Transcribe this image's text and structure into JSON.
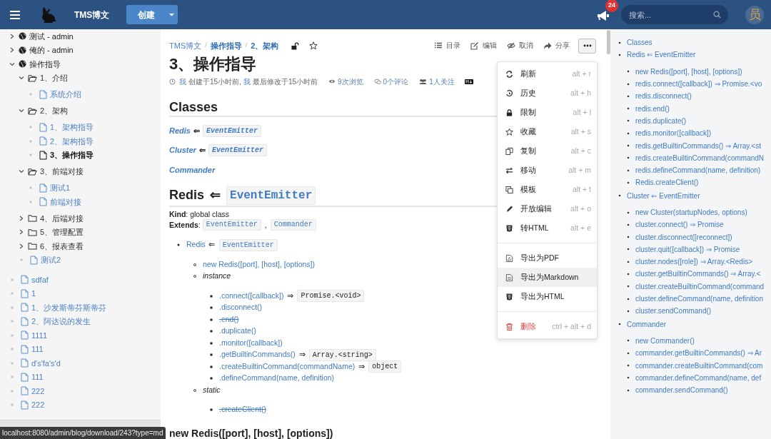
{
  "header": {
    "brand": "TMS博文",
    "create_button": "创建",
    "notification_count": "24",
    "search": {
      "placeholder": "搜索..."
    },
    "avatar": "员"
  },
  "sidebar": {
    "tree": [
      {
        "kind": "group",
        "label": "测试 - admin",
        "expanded": false
      },
      {
        "kind": "group",
        "label": "俺的 - admin",
        "expanded": false
      },
      {
        "kind": "group",
        "label": "操作指导",
        "expanded": true,
        "children": [
          {
            "kind": "folder",
            "label": "1、介绍",
            "expanded": true,
            "children": [
              {
                "kind": "doc",
                "label": "系统介绍",
                "selected": false
              }
            ]
          },
          {
            "kind": "folder",
            "label": "2、架构",
            "expanded": true,
            "children": [
              {
                "kind": "doc",
                "label": "1、架构指导",
                "selected": false
              },
              {
                "kind": "doc",
                "label": "2、架构指导",
                "selected": false
              },
              {
                "kind": "doc",
                "label": "3、操作指导",
                "selected": true
              }
            ]
          },
          {
            "kind": "folder",
            "label": "3、前端对接",
            "expanded": true,
            "children": [
              {
                "kind": "doc",
                "label": "测试1",
                "selected": false
              },
              {
                "kind": "doc",
                "label": "前端对接",
                "selected": false
              }
            ]
          },
          {
            "kind": "folder",
            "label": "4、后端对接",
            "expanded": false
          },
          {
            "kind": "folder",
            "label": "5、管理配置",
            "expanded": false
          },
          {
            "kind": "folder",
            "label": "6、报表查看",
            "expanded": false
          },
          {
            "kind": "doc",
            "label": "测试2",
            "selected": false
          }
        ]
      },
      {
        "kind": "doc",
        "label": "sdfaf",
        "selected": false
      },
      {
        "kind": "doc",
        "label": "1",
        "selected": false
      },
      {
        "kind": "doc",
        "label": "1、沙发斯蒂芬斯蒂芬",
        "selected": false
      },
      {
        "kind": "doc",
        "label": "2、阿达说的发生",
        "selected": false
      },
      {
        "kind": "doc",
        "label": "1111",
        "selected": false
      },
      {
        "kind": "doc",
        "label": "111",
        "selected": false
      },
      {
        "kind": "doc",
        "label": "d's'fa's'd",
        "selected": false
      },
      {
        "kind": "doc",
        "label": "111",
        "selected": false
      },
      {
        "kind": "doc",
        "label": "222",
        "selected": false
      },
      {
        "kind": "doc",
        "label": "222",
        "selected": false
      }
    ]
  },
  "breadcrumb": [
    "TMS博文",
    "操作指导",
    "2、架构"
  ],
  "breadcrumb_separators": [
    "/",
    "/"
  ],
  "toolbar": [
    "目录",
    "编辑",
    "取消",
    "分享"
  ],
  "title": "3、操作指导",
  "meta": {
    "creator": "我",
    "created": "创建于15小时前,",
    "modifier": "我",
    "modified": "最后修改于15小时前",
    "views": "9次浏览",
    "comments": "0个评论",
    "followers": "1人关注"
  },
  "menu": {
    "groups": [
      [
        {
          "label": "刷新",
          "shortcut": "alt + r",
          "kind": "normal",
          "selected": false
        },
        {
          "label": "历史",
          "shortcut": "alt + h",
          "kind": "normal",
          "selected": false
        },
        {
          "label": "限制",
          "shortcut": "alt + l",
          "kind": "normal",
          "selected": false
        },
        {
          "label": "收藏",
          "shortcut": "alt + s",
          "kind": "normal",
          "selected": false
        },
        {
          "label": "复制",
          "shortcut": "alt + c",
          "kind": "normal",
          "selected": false
        },
        {
          "label": "移动",
          "shortcut": "alt + m",
          "kind": "normal",
          "selected": false
        },
        {
          "label": "模板",
          "shortcut": "alt + t",
          "kind": "normal",
          "selected": false
        },
        {
          "label": "开放编辑",
          "shortcut": "alt + o",
          "kind": "normal",
          "selected": false
        },
        {
          "label": "转HTML",
          "shortcut": "alt + e",
          "kind": "normal",
          "selected": false
        }
      ],
      [
        {
          "label": "导出为PDF",
          "kind": "normal",
          "selected": false
        },
        {
          "label": "导出为Markdown",
          "kind": "normal",
          "selected": true
        },
        {
          "label": "导出为HTML",
          "kind": "normal",
          "selected": false
        }
      ],
      [
        {
          "label": "删除",
          "shortcut": "ctrl + alt + d",
          "kind": "danger",
          "selected": false
        }
      ]
    ]
  },
  "doc": {
    "classes_heading": "Classes",
    "classes": [
      {
        "name": "Redis",
        "arrow": "⇐",
        "extends": "EventEmitter"
      },
      {
        "name": "Cluster",
        "arrow": "⇐",
        "extends": "EventEmitter"
      },
      {
        "name": "Commander"
      }
    ],
    "section": {
      "name": "Redis",
      "arrow": "⇐",
      "extends": "EventEmitter"
    },
    "kind_label": "Kind",
    "kind_value": ": global class",
    "extends_label": "Extends",
    "extends_sep": ": ",
    "extends": [
      "EventEmitter",
      "Commander"
    ],
    "extends_comma": ",",
    "outline": {
      "name": "Redis",
      "arrow": "⇐",
      "extends": "EventEmitter",
      "constructor": "new Redis([port], [host], [options])",
      "groups": [
        {
          "label": "instance",
          "members": [
            {
              "name": ".connect([callback])",
              "arrow": "⇒",
              "returns": "Promise.<void>",
              "deprecated": false
            },
            {
              "name": ".disconnect()",
              "deprecated": false
            },
            {
              "name": ".end()",
              "deprecated": true
            },
            {
              "name": ".duplicate()",
              "deprecated": false
            },
            {
              "name": ".monitor([callback])",
              "deprecated": false
            },
            {
              "name": ".getBuiltinCommands()",
              "arrow": "⇒",
              "returns": "Array.<string>",
              "deprecated": false
            },
            {
              "name": ".createBuiltinCommand(commandName)",
              "arrow": "⇒",
              "returns": "object",
              "deprecated": false
            },
            {
              "name": ".defineCommand(name, definition)",
              "deprecated": false
            }
          ]
        },
        {
          "label": "static",
          "members": [
            {
              "name": ".createClient()",
              "deprecated": true
            }
          ]
        }
      ]
    },
    "next_heading": "new Redis([port], [host], [options])"
  },
  "toc": [
    {
      "label": "Classes"
    },
    {
      "label": "Redis ⇐ EventEmitter",
      "children": [
        "new Redis([port], [host], [options])",
        "redis.connect([callback]) ⇒ Promise.<vo",
        "redis.disconnect()",
        "redis.end()",
        "redis.duplicate()",
        "redis.monitor([callback])",
        "redis.getBuiltinCommands() ⇒ Array.<st",
        "redis.createBuiltinCommand(commandN",
        "redis.defineCommand(name, definition)",
        "Redis.createClient()"
      ]
    },
    {
      "label": "Cluster ⇐ EventEmitter",
      "children": [
        "new Cluster(startupNodes, options)",
        "cluster.connect() ⇒ Promise",
        "cluster.disconnect([reconnect])",
        "cluster.quit([callback]) ⇒ Promise",
        "cluster.nodes([role]) ⇒ Array.<Redis>",
        "cluster.getBuiltinCommands() ⇒ Array.<",
        "cluster.createBuiltinCommand(command",
        "cluster.defineCommand(name, definition",
        "cluster.sendCommand()"
      ]
    },
    {
      "label": "Commander",
      "children": [
        "new Commander()",
        "commander.getBuiltinCommands() ⇒ Ar",
        "commander.createBuiltinCommand(com",
        "commander.defineCommand(name, def",
        "commander.sendCommand()"
      ]
    }
  ],
  "status_url": "localhost:8080/admin/blog/download/243?type=md"
}
